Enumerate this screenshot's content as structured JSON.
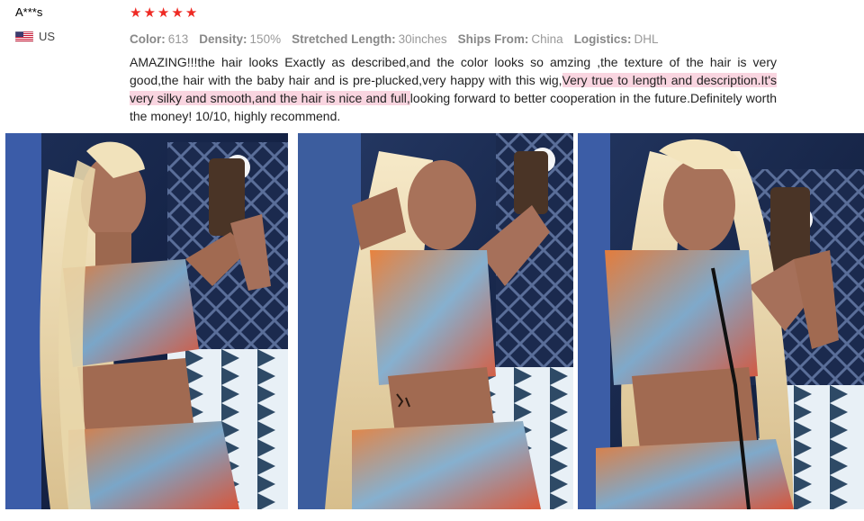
{
  "reviewer": {
    "name": "A***s",
    "country": "US",
    "flag_icon": "us-flag-icon"
  },
  "rating": {
    "stars": 5,
    "star_glyph": "★",
    "color": "#ee2a24"
  },
  "meta": {
    "color_label": "Color:",
    "color_value": "613",
    "density_label": "Density:",
    "density_value": "150%",
    "length_label": "Stretched Length:",
    "length_value": "30inches",
    "ships_label": "Ships From:",
    "ships_value": "China",
    "logistics_label": "Logistics:",
    "logistics_value": "DHL"
  },
  "review": {
    "text_before": "AMAZING!!!the hair looks Exactly as described,and the color looks so amzing ,the texture of the hair is very good,the hair with the baby hair and is pre-plucked,very happy with this wig,",
    "text_highlight": "Very true to length and description.It's very silky and smooth,and the hair is nice and full,",
    "text_after": "looking forward to better cooperation in the future.Definitely worth the money! 10/10, highly recommend.",
    "highlight_color": "#f9d5e0"
  },
  "photos": [
    {
      "name": "review-photo-1"
    },
    {
      "name": "review-photo-2"
    },
    {
      "name": "review-photo-3"
    }
  ]
}
